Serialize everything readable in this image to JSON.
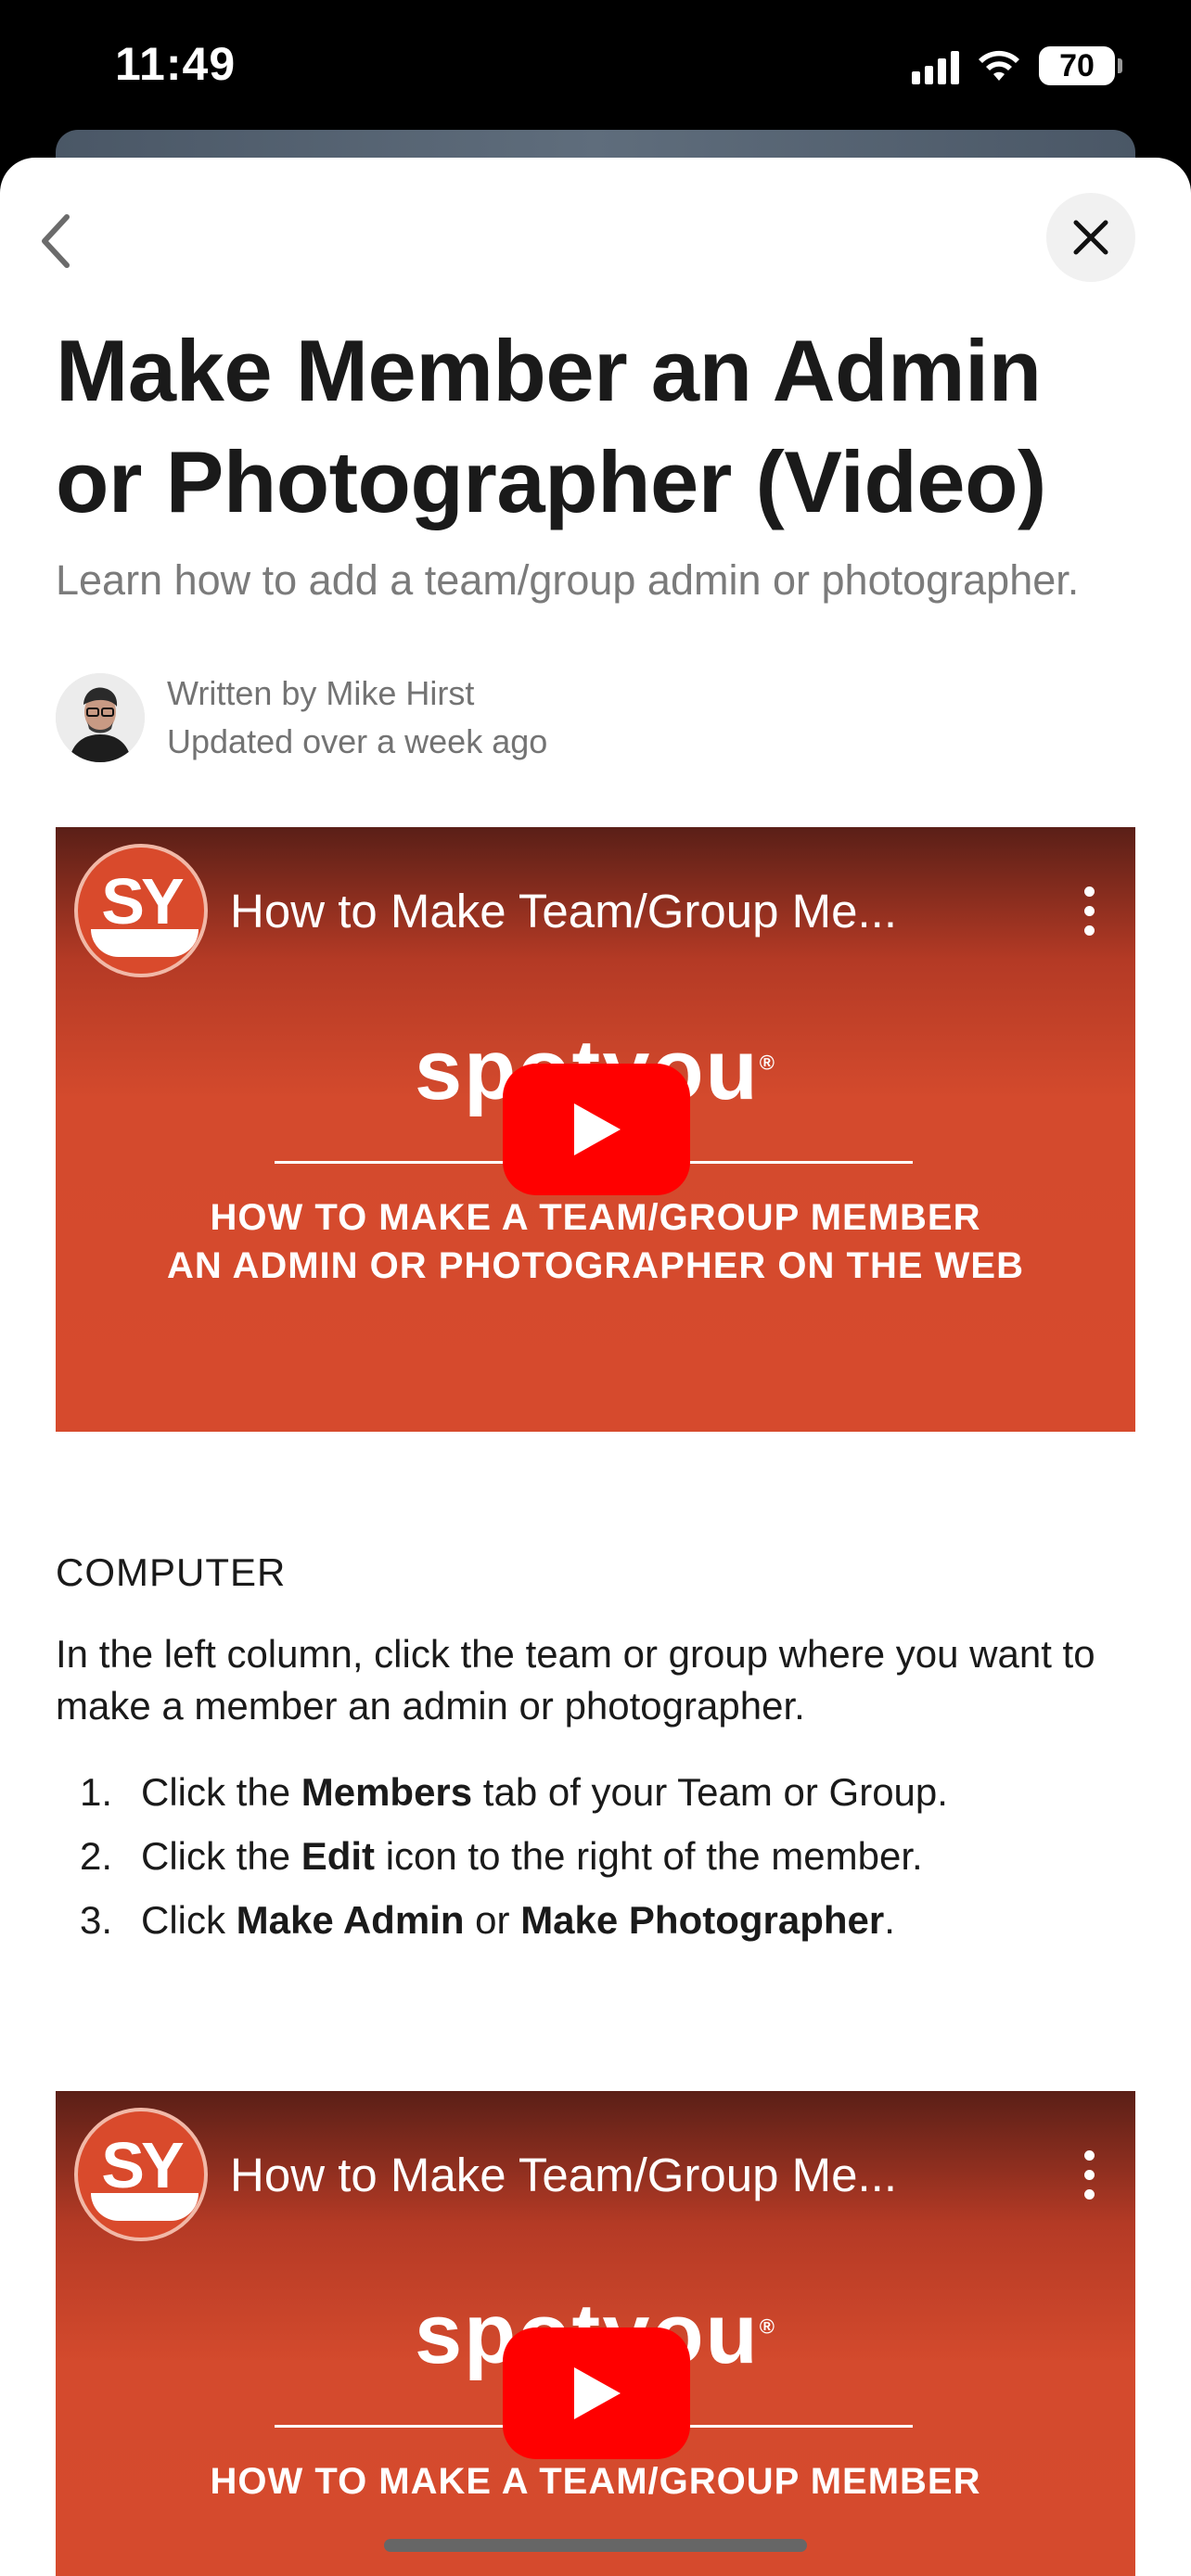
{
  "status_bar": {
    "time": "11:49",
    "battery": "70",
    "icons": [
      "cellular-signal-icon",
      "wifi-icon",
      "battery-icon"
    ]
  },
  "nav": {
    "back_icon": "chevron-left-icon",
    "close_icon": "close-icon"
  },
  "article": {
    "title": "Make Member an Admin or Photographer (Video)",
    "subtitle": "Learn how to add a team/group admin or photographer.",
    "author_line": "Written by Mike Hirst",
    "updated_line": "Updated over a week ago"
  },
  "videos": [
    {
      "title": "How to Make Team/Group Me...",
      "channel_logo_text": "SY",
      "brand_text": "spotyou",
      "brand_mark": "®",
      "caption_line1": "HOW TO MAKE A TEAM/GROUP MEMBER",
      "caption_line2": "AN ADMIN OR PHOTOGRAPHER ON THE WEB"
    },
    {
      "title": "How to Make Team/Group Me...",
      "channel_logo_text": "SY",
      "brand_text": "spotyou",
      "brand_mark": "®",
      "caption_line1": "HOW TO MAKE A TEAM/GROUP MEMBER",
      "caption_line2": ""
    }
  ],
  "instructions": {
    "heading": "COMPUTER",
    "intro": "In the left column, click the team or group where you want to make a member an admin or photographer.",
    "steps": [
      {
        "num": "1.",
        "pre": "Click the ",
        "bold1": "Members",
        "mid": " tab of your Team or Group.",
        "bold2": "",
        "post": ""
      },
      {
        "num": "2.",
        "pre": "Click the ",
        "bold1": "Edit",
        "mid": " icon to the right of the member.",
        "bold2": "",
        "post": ""
      },
      {
        "num": "3.",
        "pre": "Click ",
        "bold1": "Make Admin",
        "mid": " or ",
        "bold2": "Make Photographer",
        "post": "."
      }
    ]
  },
  "colors": {
    "video_red": "#d64a2d",
    "play_red": "#ff0000",
    "text_primary": "#1a1a1a",
    "text_secondary": "#7b7b7b"
  }
}
